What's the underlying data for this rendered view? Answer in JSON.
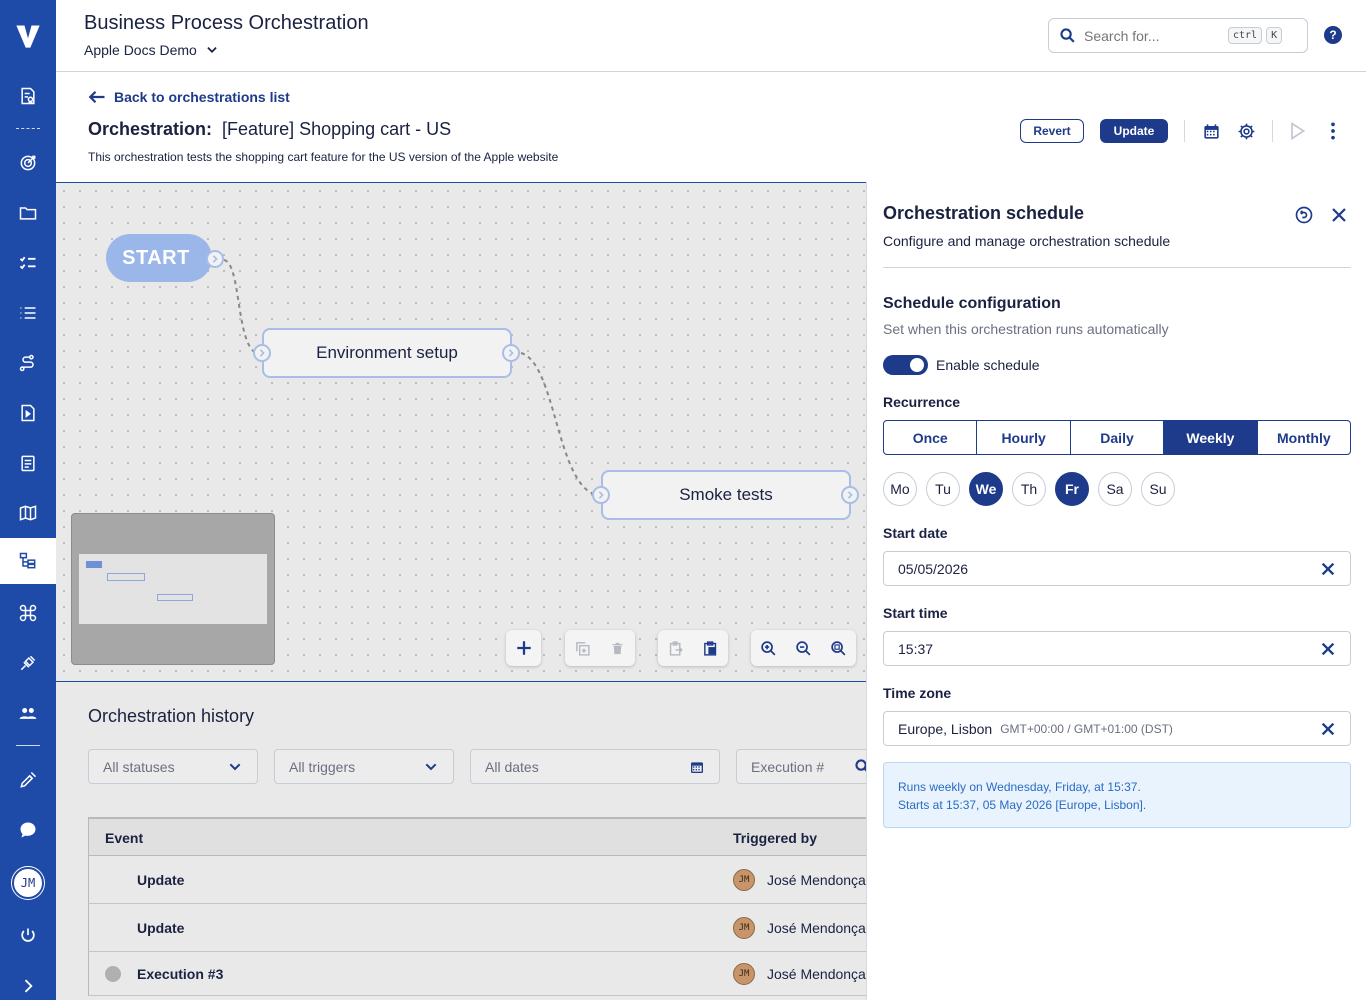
{
  "header": {
    "app_title": "Business Process Orchestration",
    "project": "Apple Docs Demo",
    "search_placeholder": "Search for...",
    "search_kbd_1": "ctrl",
    "search_kbd_2": "K",
    "help": "?"
  },
  "rail": {
    "user_initials": "JM",
    "icons": [
      "logo-v-icon",
      "reports-icon",
      "target-icon",
      "folder-icon",
      "checklist-icon",
      "list-icon",
      "flow-icon",
      "document-play-icon",
      "clipboard-list-icon",
      "map-icon",
      "orchestration-icon",
      "command-icon",
      "plug-icon",
      "users-icon",
      "pen-tool-icon",
      "chat-icon",
      "avatar",
      "power-icon",
      "expand-icon"
    ]
  },
  "page": {
    "back_label": "Back to orchestrations list",
    "title_prefix": "Orchestration:",
    "title": "[Feature] Shopping cart - US",
    "description": "This orchestration tests the shopping cart feature for the US version of the Apple website",
    "revert_label": "Revert",
    "update_label": "Update"
  },
  "canvas": {
    "start_label": "START",
    "nodes": [
      "Environment setup",
      "Smoke tests"
    ]
  },
  "history": {
    "title": "Orchestration history",
    "filters": {
      "status": "All statuses",
      "trigger": "All triggers",
      "dates": "All dates",
      "execution_placeholder": "Execution #"
    },
    "columns": {
      "event": "Event",
      "triggered_by": "Triggered by"
    },
    "rows": [
      {
        "event": "Update",
        "user": "José Mendonça",
        "initials": "JM"
      },
      {
        "event": "Update",
        "user": "José Mendonça",
        "initials": "JM"
      },
      {
        "event": "Execution #3",
        "user": "José Mendonça",
        "initials": "JM"
      }
    ]
  },
  "schedule": {
    "title": "Orchestration schedule",
    "subtitle": "Configure and manage orchestration schedule",
    "section_title": "Schedule configuration",
    "section_sub": "Set when this orchestration runs automatically",
    "enable_label": "Enable schedule",
    "enabled": true,
    "recurrence_label": "Recurrence",
    "recurrence_options": [
      "Once",
      "Hourly",
      "Daily",
      "Weekly",
      "Monthly"
    ],
    "recurrence_selected": "Weekly",
    "days": [
      "Mo",
      "Tu",
      "We",
      "Th",
      "Fr",
      "Sa",
      "Su"
    ],
    "days_selected": [
      "We",
      "Fr"
    ],
    "start_date_label": "Start date",
    "start_date": "05/05/2026",
    "start_time_label": "Start time",
    "start_time": "15:37",
    "timezone_label": "Time zone",
    "timezone": "Europe, Lisbon",
    "timezone_offset": "GMT+00:00 / GMT+01:00 (DST)",
    "summary_line1": "Runs weekly on Wednesday, Friday, at 15:37.",
    "summary_line2": "Starts at 15:37, 05 May 2026 [Europe, Lisbon]."
  },
  "colors": {
    "brand": "#1e3a8a",
    "rail": "#1e4aa8",
    "node_border": "#a9bde6",
    "info_bg": "#e8f3fd"
  }
}
